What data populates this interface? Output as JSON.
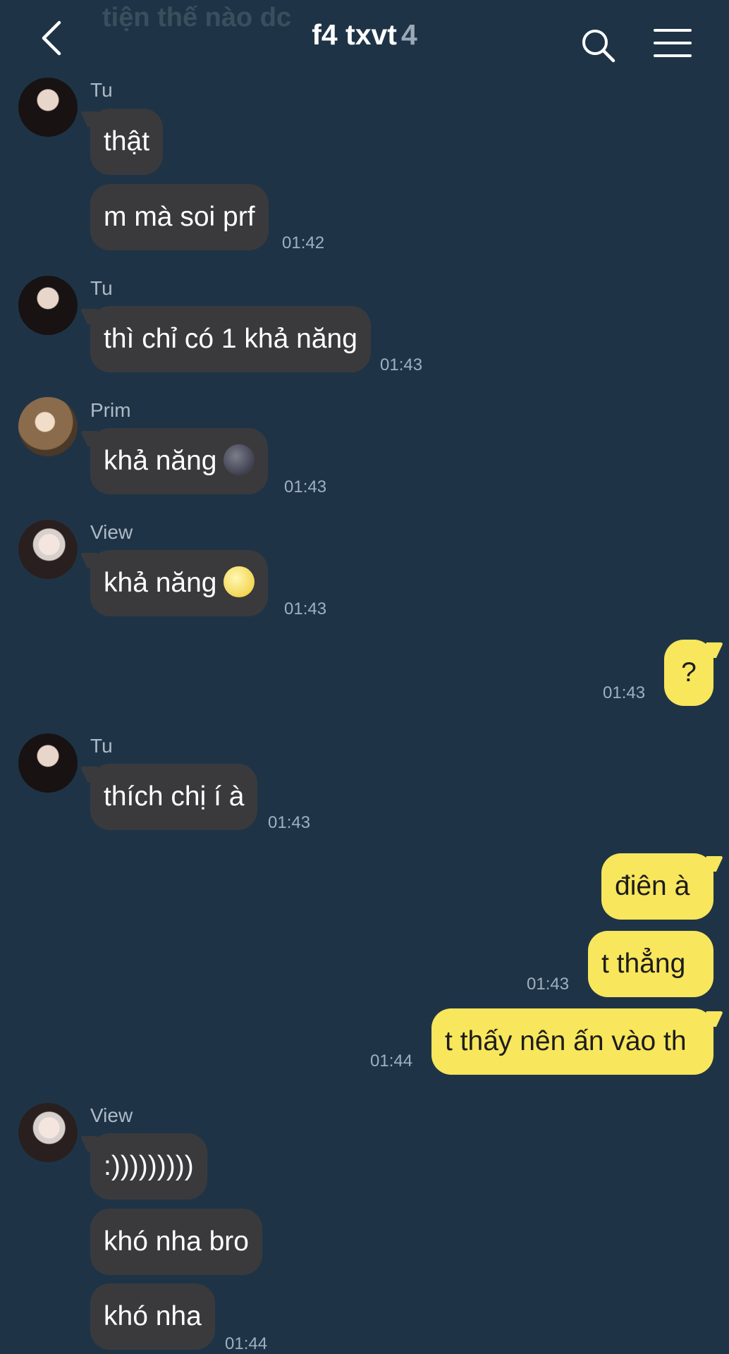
{
  "header": {
    "ghost_text": "tiện thế nào dc",
    "title": "f4 txvt",
    "member_count": "4",
    "icons": [
      "chevron-left-icon",
      "search-icon",
      "menu-icon"
    ]
  },
  "messages": [
    {
      "sender": "Tu",
      "texts": [
        "thật",
        "m mà soi prf"
      ],
      "time": "01:42"
    },
    {
      "sender": "Tu",
      "texts": [
        "thì chỉ có 1 khả năng"
      ],
      "time": "01:43"
    },
    {
      "sender": "Prim",
      "texts": [
        "khả năng"
      ],
      "emoji": "new-moon-face",
      "time": "01:43"
    },
    {
      "sender": "View",
      "texts": [
        "khả năng"
      ],
      "emoji": "full-moon-face",
      "time": "01:43"
    },
    {
      "sender": "me",
      "texts": [
        "?"
      ],
      "time": "01:43"
    },
    {
      "sender": "Tu",
      "texts": [
        "thích chị í à"
      ],
      "time": "01:43"
    },
    {
      "sender": "me",
      "texts": [
        "điên à",
        "t thẳng"
      ],
      "time": "01:43"
    },
    {
      "sender": "me",
      "texts": [
        "t thấy nên ấn vào th"
      ],
      "time": "01:44"
    },
    {
      "sender": "View",
      "texts": [
        ":)))))))))",
        "khó nha bro",
        "khó nha"
      ],
      "time": "01:44"
    }
  ],
  "colors": {
    "background": "#1e3446",
    "incoming_bubble": "#3a3a3d",
    "outgoing_bubble": "#f8e65c"
  }
}
